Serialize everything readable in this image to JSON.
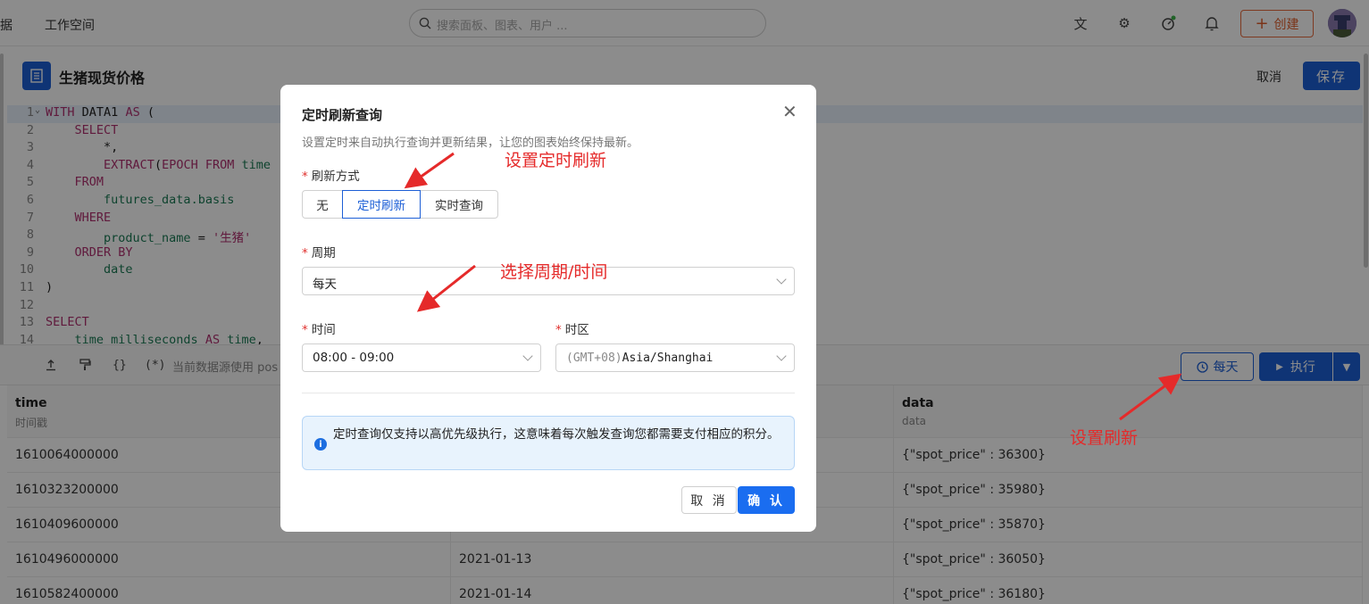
{
  "topbar": {
    "nav_cut": "据",
    "workspace": "工作空间",
    "search_placeholder": "搜索面板、图表、用户 ...",
    "create_label": "创建"
  },
  "editor": {
    "title": "生猪现货价格",
    "cancel_label": "取消",
    "save_label": "保存"
  },
  "code_lines": [
    {
      "n": "1",
      "text": "WITH DATA1 AS ("
    },
    {
      "n": "2",
      "text": "    SELECT"
    },
    {
      "n": "3",
      "text": "        *,"
    },
    {
      "n": "4",
      "text": "        EXTRACT(EPOCH FROM time"
    },
    {
      "n": "5",
      "text": "    FROM"
    },
    {
      "n": "6",
      "text": "        futures_data.basis"
    },
    {
      "n": "7",
      "text": "    WHERE"
    },
    {
      "n": "8",
      "text": "        product_name = '生猪'"
    },
    {
      "n": "9",
      "text": "    ORDER BY"
    },
    {
      "n": "10",
      "text": "        date"
    },
    {
      "n": "11",
      "text": ")"
    },
    {
      "n": "12",
      "text": ""
    },
    {
      "n": "13",
      "text": "SELECT"
    },
    {
      "n": "14",
      "text": "    time_milliseconds AS time,"
    }
  ],
  "toolbar": {
    "braces": "{}",
    "star_paren": "(*)",
    "datasource_text": "当前数据源使用 pos",
    "daily_label": "每天",
    "run_label": "执行"
  },
  "table": {
    "columns": [
      {
        "name": "time",
        "sub": "时间戳"
      },
      {
        "name": "",
        "sub": ""
      },
      {
        "name": "data",
        "sub": "data"
      }
    ],
    "rows": [
      [
        "1610064000000",
        "",
        "{\"spot_price\" : 36300}"
      ],
      [
        "1610323200000",
        "",
        "{\"spot_price\" : 35980}"
      ],
      [
        "1610409600000",
        "",
        "{\"spot_price\" : 35870}"
      ],
      [
        "1610496000000",
        "2021-01-13",
        "{\"spot_price\" : 36050}"
      ],
      [
        "1610582400000",
        "2021-01-14",
        "{\"spot_price\" : 36180}"
      ]
    ]
  },
  "modal": {
    "title": "定时刷新查询",
    "description": "设置定时来自动执行查询并更新结果，让您的图表始终保持最新。",
    "refresh_label": "刷新方式",
    "refresh_options": [
      "无",
      "定时刷新",
      "实时查询"
    ],
    "refresh_selected": "定时刷新",
    "period_label": "周期",
    "period_value": "每天",
    "time_label": "时间",
    "time_value": "08:00 - 09:00",
    "timezone_label": "时区",
    "timezone_prefix": "(GMT+08)",
    "timezone_value": "Asia/Shanghai",
    "alert_text": "定时查询仅支持以高优先级执行，这意味着每次触发查询您都需要支付相应的积分。",
    "cancel_label": "取 消",
    "confirm_label": "确 认"
  },
  "annotations": {
    "a1": "设置定时刷新",
    "a2": "选择周期/时间",
    "a3": "设置刷新",
    "color": "#e52a2a"
  }
}
